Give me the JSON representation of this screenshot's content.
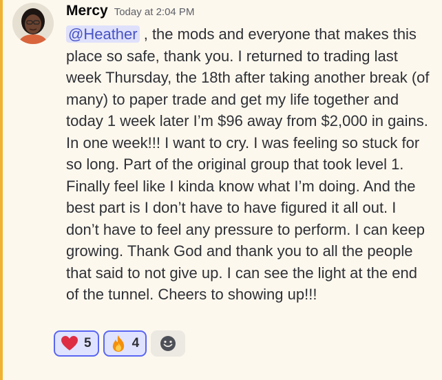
{
  "message": {
    "author": "Mercy",
    "timestamp": "Today at 2:04 PM",
    "mention": "@Heather",
    "text": " , the mods and everyone that makes this place so safe, thank you. I returned to trading last week Thursday, the 18th after taking another break (of many) to paper trade and get my life together and today 1 week later I’m $96 away from $2,000 in gains. In one week!!! I want to cry. I was feeling so stuck for so long. Part of the original group that took level 1. Finally feel like I kinda know what I’m doing. And the best part is I don’t have to have figured it all out. I don’t have to feel any pressure to perform. I can keep growing. Thank God and thank you to all the people that said to not give up. I can see the light at the end of the tunnel. Cheers to showing up!!!"
  },
  "reactions": [
    {
      "emoji": "heart-emoji",
      "count": "5"
    },
    {
      "emoji": "fire-emoji",
      "count": "4"
    }
  ],
  "add_reaction_icon": "smiley-add-reaction-icon",
  "colors": {
    "highlight": "#f0b232",
    "mention_bg": "#dfe1fb",
    "mention_text": "#4752c4",
    "reaction_border": "#5865f2"
  }
}
